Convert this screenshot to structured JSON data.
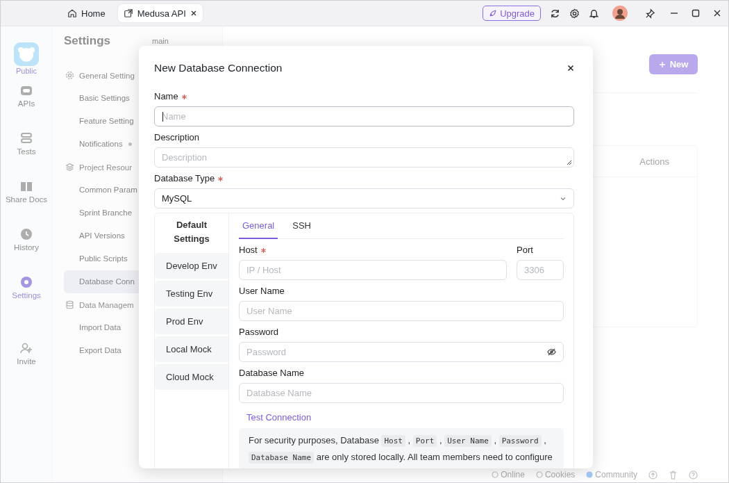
{
  "title_bar": {
    "tabs": [
      {
        "label": "Home",
        "selected": false,
        "closable": false
      },
      {
        "label": "Medusa API",
        "selected": true,
        "closable": true
      }
    ],
    "upgrade": "Upgrade"
  },
  "rail": {
    "workspace": "Public",
    "items": [
      {
        "label": "APIs",
        "selected": false
      },
      {
        "label": "Tests",
        "selected": false
      },
      {
        "label": "Share Docs",
        "selected": false
      },
      {
        "label": "History",
        "selected": false
      },
      {
        "label": "Settings",
        "selected": true
      },
      {
        "label": "Invite",
        "selected": false
      }
    ]
  },
  "settings_nav": {
    "title": "Settings",
    "branch": "main",
    "groups": [
      {
        "label": "General Setting",
        "items": [
          {
            "label": "Basic Settings",
            "selected": false,
            "dot": false
          },
          {
            "label": "Feature Setting",
            "selected": false,
            "dot": false
          },
          {
            "label": "Notifications",
            "selected": false,
            "dot": true
          }
        ]
      },
      {
        "label": "Project Resour",
        "items": [
          {
            "label": "Common Param",
            "selected": false,
            "dot": false
          },
          {
            "label": "Sprint Branche",
            "selected": false,
            "dot": false
          },
          {
            "label": "API Versions",
            "selected": false,
            "dot": false
          },
          {
            "label": "Public Scripts",
            "selected": false,
            "dot": false
          },
          {
            "label": "Database Conn",
            "selected": true,
            "dot": false
          }
        ]
      },
      {
        "label": "Data Managem",
        "items": [
          {
            "label": "Import Data",
            "selected": false,
            "dot": false
          },
          {
            "label": "Export Data",
            "selected": false,
            "dot": false
          }
        ]
      }
    ]
  },
  "main": {
    "new_button": "New",
    "table": {
      "columns": [
        "Actions"
      ]
    }
  },
  "status_bar": {
    "items": [
      "Online",
      "Cookies",
      "Community"
    ]
  },
  "dialog": {
    "title": "New Database Connection",
    "fields": [
      {
        "kind": "input",
        "label": "Name",
        "required": true,
        "placeholder": "Name",
        "focused": true
      },
      {
        "kind": "textarea",
        "label": "Description",
        "required": false,
        "placeholder": "Description",
        "focused": false
      },
      {
        "kind": "select",
        "label": "Database Type",
        "required": true,
        "value": "MySQL",
        "focused": false
      }
    ],
    "environments": [
      {
        "label": "Default Settings",
        "selected": true
      },
      {
        "label": "Develop Env",
        "selected": false
      },
      {
        "label": "Testing Env",
        "selected": false
      },
      {
        "label": "Prod Env",
        "selected": false
      },
      {
        "label": "Local Mock",
        "selected": false
      },
      {
        "label": "Cloud Mock",
        "selected": false
      }
    ],
    "tabs": [
      {
        "label": "General",
        "selected": true
      },
      {
        "label": "SSH",
        "selected": false
      }
    ],
    "host": {
      "label": "Host",
      "required": true,
      "placeholder": "IP / Host"
    },
    "port": {
      "label": "Port",
      "required": false,
      "placeholder": "3306"
    },
    "connection_fields": [
      {
        "kind": "text",
        "label": "User Name",
        "required": false,
        "placeholder": "User Name"
      },
      {
        "kind": "password",
        "label": "Password",
        "required": false,
        "placeholder": "Password"
      },
      {
        "kind": "text",
        "label": "Database Name",
        "required": false,
        "placeholder": "Database Name"
      }
    ],
    "test_link": "Test Connection",
    "note": [
      {
        "kind": "text",
        "text": "For security purposes, Database "
      },
      {
        "kind": "code",
        "text": "Host"
      },
      {
        "kind": "text",
        "text": " , "
      },
      {
        "kind": "code",
        "text": "Port"
      },
      {
        "kind": "text",
        "text": " , "
      },
      {
        "kind": "code",
        "text": "User Name"
      },
      {
        "kind": "text",
        "text": " , "
      },
      {
        "kind": "code",
        "text": "Password"
      },
      {
        "kind": "text",
        "text": " , "
      },
      {
        "kind": "code",
        "text": "Database Name"
      },
      {
        "kind": "text",
        "text": " are only stored locally. All team members need to configure"
      }
    ]
  }
}
